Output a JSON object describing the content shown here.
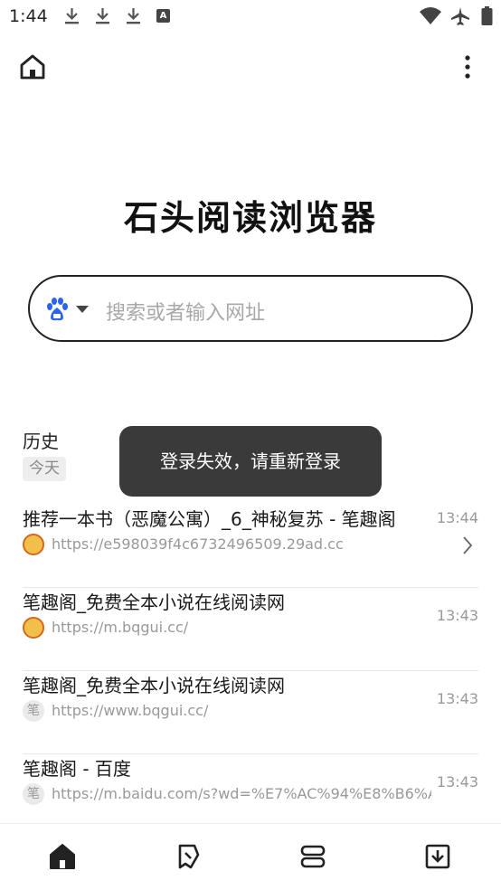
{
  "status_bar": {
    "time": "1:44",
    "icons": [
      "download-icon",
      "download-icon",
      "download-icon",
      "a-icon",
      "wifi-icon",
      "airplane-icon",
      "battery-icon"
    ],
    "a_glyph": "A"
  },
  "header": {
    "home_icon": "home-icon",
    "more_icon": "more-vert-icon"
  },
  "brand": {
    "title": "石头阅读浏览器"
  },
  "search": {
    "engine_icon": "baidu-icon",
    "placeholder": "搜索或者输入网址"
  },
  "history": {
    "title": "历史",
    "group_label": "今天",
    "items": [
      {
        "title": "推荐一本书（恶魔公寓）_6_神秘复苏 - 笔趣阁",
        "url": "https://e598039f4c6732496509.29ad.cc",
        "time": "13:44",
        "favicon": "book-icon"
      },
      {
        "title": "笔趣阁_免费全本小说在线阅读网",
        "url": "https://m.bqgui.cc/",
        "time": "13:43",
        "favicon": "book-icon"
      },
      {
        "title": "笔趣阁_免费全本小说在线阅读网",
        "url": "https://www.bqgui.cc/",
        "time": "13:43",
        "favicon": "笔"
      },
      {
        "title": "笔趣阁 - 百度",
        "url": "https://m.baidu.com/s?wd=%E7%AC%94%E8%B6%A...",
        "time": "13:43",
        "favicon": "笔"
      }
    ]
  },
  "toast": {
    "message": "登录失效，请重新登录"
  },
  "bottom_nav": {
    "items": [
      "home-icon",
      "bookmark-icon",
      "tabs-icon",
      "download-icon"
    ]
  },
  "colors": {
    "accent": "#111111",
    "toast_bg": "#3a3a3a",
    "baidu_blue": "#2b63f0"
  }
}
